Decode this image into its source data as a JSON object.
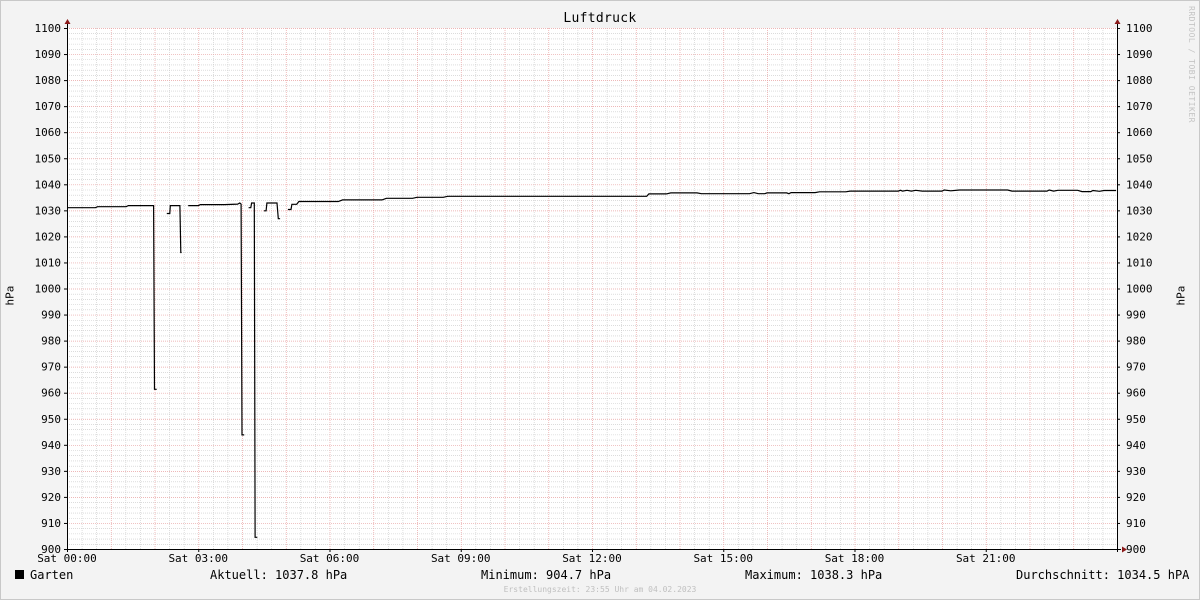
{
  "chart_data": {
    "type": "line",
    "title": "Luftdruck",
    "ylabel": "hPa",
    "xlabel": "",
    "ylim": [
      900,
      1100
    ],
    "xlim": [
      0,
      24
    ],
    "y_ticks": [
      900,
      910,
      920,
      930,
      940,
      950,
      960,
      970,
      980,
      990,
      1000,
      1010,
      1020,
      1030,
      1040,
      1050,
      1060,
      1070,
      1080,
      1090,
      1100
    ],
    "x_ticks": [
      {
        "hour": 0,
        "label": "Sat 00:00"
      },
      {
        "hour": 3,
        "label": "Sat 03:00"
      },
      {
        "hour": 6,
        "label": "Sat 06:00"
      },
      {
        "hour": 9,
        "label": "Sat 09:00"
      },
      {
        "hour": 12,
        "label": "Sat 12:00"
      },
      {
        "hour": 15,
        "label": "Sat 15:00"
      },
      {
        "hour": 18,
        "label": "Sat 18:00"
      },
      {
        "hour": 21,
        "label": "Sat 21:00"
      }
    ],
    "grid": true,
    "series": [
      {
        "name": "Garten",
        "color": "#000000",
        "points": [
          [
            0.0,
            1031.2
          ],
          [
            0.65,
            1031.2
          ],
          [
            0.7,
            1031.6
          ],
          [
            1.35,
            1031.6
          ],
          [
            1.4,
            1032.0
          ],
          [
            1.98,
            1032.0
          ],
          [
            2.0,
            961.5
          ],
          [
            2.05,
            961.5
          ],
          [
            2.05,
            null
          ],
          [
            2.28,
            1029.0
          ],
          [
            2.35,
            1029.0
          ],
          [
            2.36,
            1032.0
          ],
          [
            2.58,
            1032.0
          ],
          [
            2.6,
            1014.0
          ],
          [
            2.62,
            1014.0
          ],
          [
            2.62,
            null
          ],
          [
            2.77,
            1032.0
          ],
          [
            3.0,
            1032.0
          ],
          [
            3.05,
            1032.4
          ],
          [
            3.6,
            1032.4
          ],
          [
            3.9,
            1032.6
          ],
          [
            3.95,
            1033.0
          ],
          [
            3.98,
            1032.6
          ],
          [
            4.0,
            944.0
          ],
          [
            4.05,
            944.0
          ],
          [
            4.05,
            null
          ],
          [
            4.15,
            1031.2
          ],
          [
            4.2,
            1031.2
          ],
          [
            4.22,
            1033.0
          ],
          [
            4.28,
            1033.0
          ],
          [
            4.3,
            904.7
          ],
          [
            4.35,
            904.7
          ],
          [
            4.35,
            null
          ],
          [
            4.5,
            1030.0
          ],
          [
            4.55,
            1030.0
          ],
          [
            4.57,
            1033.0
          ],
          [
            4.8,
            1033.0
          ],
          [
            4.83,
            1027.0
          ],
          [
            4.87,
            1027.0
          ],
          [
            4.87,
            null
          ],
          [
            5.05,
            1030.5
          ],
          [
            5.12,
            1030.5
          ],
          [
            5.14,
            1032.5
          ],
          [
            5.25,
            1032.5
          ],
          [
            5.3,
            1033.6
          ],
          [
            6.2,
            1033.6
          ],
          [
            6.3,
            1034.2
          ],
          [
            7.2,
            1034.2
          ],
          [
            7.3,
            1034.8
          ],
          [
            7.9,
            1034.8
          ],
          [
            8.0,
            1035.2
          ],
          [
            8.6,
            1035.2
          ],
          [
            8.7,
            1035.6
          ],
          [
            13.25,
            1035.6
          ],
          [
            13.3,
            1036.5
          ],
          [
            13.7,
            1036.5
          ],
          [
            13.8,
            1036.9
          ],
          [
            14.4,
            1036.9
          ],
          [
            14.5,
            1036.6
          ],
          [
            15.6,
            1036.6
          ],
          [
            15.7,
            1037.0
          ],
          [
            15.8,
            1036.6
          ],
          [
            15.95,
            1036.6
          ],
          [
            16.0,
            1036.9
          ],
          [
            16.45,
            1036.9
          ],
          [
            16.5,
            1036.6
          ],
          [
            16.55,
            1037.0
          ],
          [
            17.1,
            1037.0
          ],
          [
            17.2,
            1037.3
          ],
          [
            17.8,
            1037.3
          ],
          [
            17.9,
            1037.6
          ],
          [
            19.0,
            1037.6
          ],
          [
            19.05,
            1037.9
          ],
          [
            19.1,
            1037.6
          ],
          [
            19.2,
            1037.9
          ],
          [
            19.3,
            1037.6
          ],
          [
            19.4,
            1037.9
          ],
          [
            19.55,
            1037.6
          ],
          [
            20.0,
            1037.6
          ],
          [
            20.05,
            1038.0
          ],
          [
            20.2,
            1037.7
          ],
          [
            20.4,
            1038.0
          ],
          [
            21.5,
            1038.0
          ],
          [
            21.6,
            1037.6
          ],
          [
            22.4,
            1037.6
          ],
          [
            22.45,
            1038.0
          ],
          [
            22.55,
            1037.6
          ],
          [
            22.65,
            1037.9
          ],
          [
            23.1,
            1037.9
          ],
          [
            23.2,
            1037.4
          ],
          [
            23.4,
            1037.4
          ],
          [
            23.45,
            1037.8
          ],
          [
            23.6,
            1037.5
          ],
          [
            23.7,
            1037.8
          ],
          [
            23.98,
            1037.8
          ]
        ]
      }
    ]
  },
  "legend": {
    "name": "Garten",
    "current": "Aktuell: 1037.8 hPa",
    "minimum": "Minimum: 904.7 hPa",
    "maximum": "Maximum: 1038.3 hPa",
    "average": "Durchschnitt: 1034.5 hPA"
  },
  "watermark": "RRDTOOL / TOBI OETIKER",
  "footer": "Erstellungszeit: 23:55 Uhr am 04.02.2023",
  "colors": {
    "background": "#f3f3f3",
    "plot_background": "#ffffff",
    "major_grid": "#e8a0a0",
    "minor_grid": "#c8c8c8",
    "axis": "#000000",
    "arrow": "#8b1a1a"
  }
}
